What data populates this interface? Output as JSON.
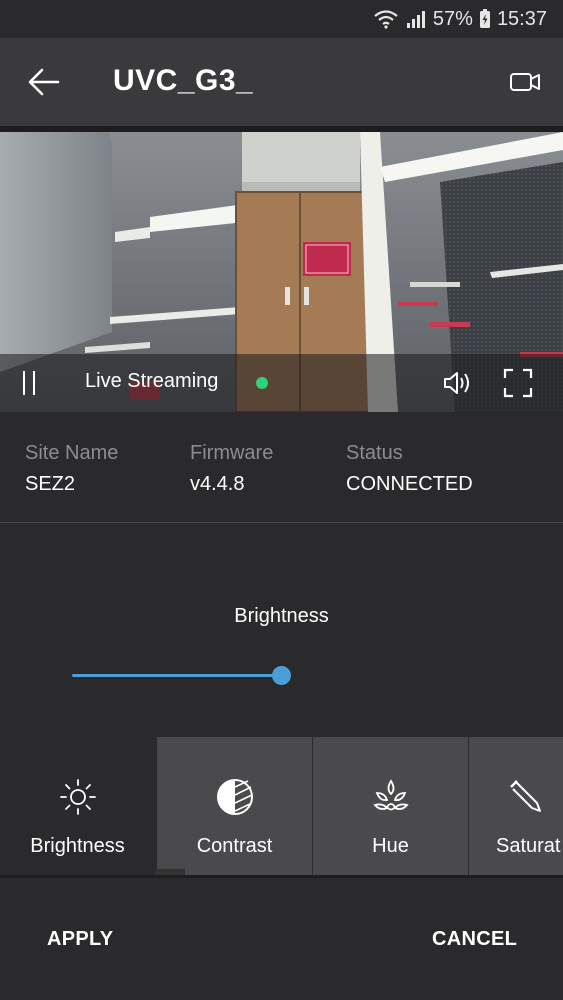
{
  "status_bar": {
    "battery": "57%",
    "time": "15:37",
    "icons": [
      "wifi-icon",
      "signal-icon",
      "battery-icon"
    ]
  },
  "toolbar": {
    "title": "UVC_G3_",
    "back_icon": "arrow-left-icon",
    "camera_icon": "video-camera-icon"
  },
  "video": {
    "live_label": "Live Streaming",
    "live_dot_color": "#2fd27a",
    "icons": [
      "pause-icon",
      "volume-icon",
      "fullscreen-icon"
    ]
  },
  "info": {
    "site_name_label": "Site Name",
    "site_name_value": "SEZ2",
    "firmware_label": "Firmware",
    "firmware_value": "v4.4.8",
    "status_label": "Status",
    "status_value": "CONNECTED"
  },
  "adjust": {
    "title": "Brightness",
    "slider_value_fraction": 1.0,
    "accent_color": "#4a9fd8"
  },
  "tabs": [
    {
      "label": "Brightness",
      "icon": "sun-icon",
      "active": true
    },
    {
      "label": "Contrast",
      "icon": "contrast-icon",
      "active": false
    },
    {
      "label": "Hue",
      "icon": "hue-icon",
      "active": false
    },
    {
      "label": "Saturat",
      "icon": "dropper-icon",
      "active": false
    }
  ],
  "actions": {
    "apply_label": "APPLY",
    "cancel_label": "CANCEL"
  }
}
